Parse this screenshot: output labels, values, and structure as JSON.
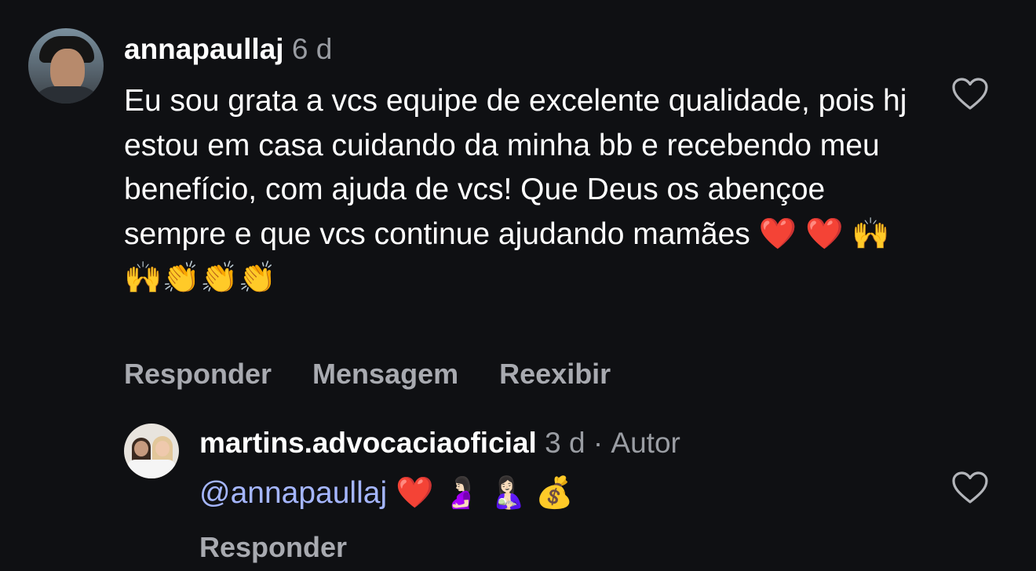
{
  "comment": {
    "username": "annapaullaj",
    "time": "6 d",
    "text": "Eu sou grata a vcs equipe de excelente qualidade, pois hj estou em casa cuidando da minha bb e recebendo meu benefício, com ajuda de vcs! Que Deus os abençoe sempre e que vcs continue ajudando mamães ❤️ ❤️ 🙌🙌👏👏👏",
    "actions": {
      "reply": "Responder",
      "message": "Mensagem",
      "unhide": "Reexibir"
    },
    "like_icon": "heart-outline-icon"
  },
  "reply": {
    "username": "martins.advocaciaoficial",
    "time": "3 d",
    "separator": "·",
    "role": "Autor",
    "mention": "@annapaullaj",
    "emojis": " ❤️  🤰🏻 🤱🏻 💰",
    "actions": {
      "reply": "Responder"
    },
    "like_icon": "heart-outline-icon"
  },
  "colors": {
    "background": "#0f1013",
    "text": "#ffffff",
    "secondary": "#9a9da3",
    "mention": "#a5b6ff"
  }
}
